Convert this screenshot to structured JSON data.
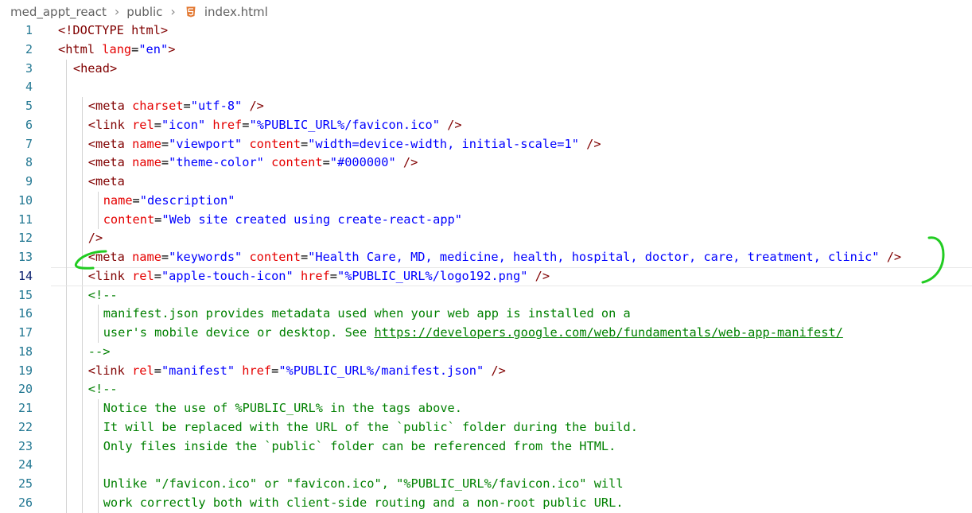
{
  "breadcrumb": {
    "items": [
      "med_appt_react",
      "public",
      "index.html"
    ],
    "file_icon": "html5-icon"
  },
  "editor": {
    "current_line": 14,
    "lines": [
      {
        "n": "1",
        "indent": 0,
        "tokens": [
          [
            "tag",
            "<!DOCTYPE html>"
          ]
        ]
      },
      {
        "n": "2",
        "indent": 0,
        "tokens": [
          [
            "tag",
            "<html"
          ],
          [
            "txt",
            " "
          ],
          [
            "attr",
            "lang"
          ],
          [
            "txt",
            "="
          ],
          [
            "str",
            "\"en\""
          ],
          [
            "tag",
            ">"
          ]
        ]
      },
      {
        "n": "3",
        "indent": 1,
        "tokens": [
          [
            "tag",
            "<head>"
          ]
        ]
      },
      {
        "n": "4",
        "indent": 1,
        "tokens": []
      },
      {
        "n": "5",
        "indent": 2,
        "tokens": [
          [
            "tag",
            "<meta"
          ],
          [
            "txt",
            " "
          ],
          [
            "attr",
            "charset"
          ],
          [
            "txt",
            "="
          ],
          [
            "str",
            "\"utf-8\""
          ],
          [
            "txt",
            " "
          ],
          [
            "tag",
            "/>"
          ]
        ]
      },
      {
        "n": "6",
        "indent": 2,
        "tokens": [
          [
            "tag",
            "<link"
          ],
          [
            "txt",
            " "
          ],
          [
            "attr",
            "rel"
          ],
          [
            "txt",
            "="
          ],
          [
            "str",
            "\"icon\""
          ],
          [
            "txt",
            " "
          ],
          [
            "attr",
            "href"
          ],
          [
            "txt",
            "="
          ],
          [
            "str",
            "\"%PUBLIC_URL%/favicon.ico\""
          ],
          [
            "txt",
            " "
          ],
          [
            "tag",
            "/>"
          ]
        ]
      },
      {
        "n": "7",
        "indent": 2,
        "tokens": [
          [
            "tag",
            "<meta"
          ],
          [
            "txt",
            " "
          ],
          [
            "attr",
            "name"
          ],
          [
            "txt",
            "="
          ],
          [
            "str",
            "\"viewport\""
          ],
          [
            "txt",
            " "
          ],
          [
            "attr",
            "content"
          ],
          [
            "txt",
            "="
          ],
          [
            "str",
            "\"width=device-width, initial-scale=1\""
          ],
          [
            "txt",
            " "
          ],
          [
            "tag",
            "/>"
          ]
        ]
      },
      {
        "n": "8",
        "indent": 2,
        "tokens": [
          [
            "tag",
            "<meta"
          ],
          [
            "txt",
            " "
          ],
          [
            "attr",
            "name"
          ],
          [
            "txt",
            "="
          ],
          [
            "str",
            "\"theme-color\""
          ],
          [
            "txt",
            " "
          ],
          [
            "attr",
            "content"
          ],
          [
            "txt",
            "="
          ],
          [
            "str",
            "\"#000000\""
          ],
          [
            "txt",
            " "
          ],
          [
            "tag",
            "/>"
          ]
        ]
      },
      {
        "n": "9",
        "indent": 2,
        "tokens": [
          [
            "tag",
            "<meta"
          ]
        ]
      },
      {
        "n": "10",
        "indent": 3,
        "tokens": [
          [
            "attr",
            "name"
          ],
          [
            "txt",
            "="
          ],
          [
            "str",
            "\"description\""
          ]
        ]
      },
      {
        "n": "11",
        "indent": 3,
        "tokens": [
          [
            "attr",
            "content"
          ],
          [
            "txt",
            "="
          ],
          [
            "str",
            "\"Web site created using create-react-app\""
          ]
        ]
      },
      {
        "n": "12",
        "indent": 2,
        "tokens": [
          [
            "tag",
            "/>"
          ]
        ]
      },
      {
        "n": "13",
        "indent": 2,
        "tokens": [
          [
            "tag",
            "<meta"
          ],
          [
            "txt",
            " "
          ],
          [
            "attr",
            "name"
          ],
          [
            "txt",
            "="
          ],
          [
            "str",
            "\"keywords\""
          ],
          [
            "txt",
            " "
          ],
          [
            "attr",
            "content"
          ],
          [
            "txt",
            "="
          ],
          [
            "str",
            "\"Health Care, MD, medicine, health, hospital, doctor, care, treatment, clinic\""
          ],
          [
            "txt",
            " "
          ],
          [
            "tag",
            "/>"
          ]
        ]
      },
      {
        "n": "14",
        "indent": 2,
        "tokens": [
          [
            "tag",
            "<link"
          ],
          [
            "txt",
            " "
          ],
          [
            "attr",
            "rel"
          ],
          [
            "txt",
            "="
          ],
          [
            "str",
            "\"apple-touch-icon\""
          ],
          [
            "txt",
            " "
          ],
          [
            "attr",
            "href"
          ],
          [
            "txt",
            "="
          ],
          [
            "str",
            "\"%PUBLIC_URL%/logo192.png\""
          ],
          [
            "txt",
            " "
          ],
          [
            "tag",
            "/>"
          ]
        ]
      },
      {
        "n": "15",
        "indent": 2,
        "tokens": [
          [
            "cmt",
            "<!--"
          ]
        ]
      },
      {
        "n": "16",
        "indent": 3,
        "tokens": [
          [
            "cmt",
            "manifest.json provides metadata used when your web app is installed on a"
          ]
        ]
      },
      {
        "n": "17",
        "indent": 3,
        "tokens": [
          [
            "cmt",
            "user's mobile device or desktop. See "
          ],
          [
            "link",
            "https://developers.google.com/web/fundamentals/web-app-manifest/"
          ]
        ]
      },
      {
        "n": "18",
        "indent": 2,
        "tokens": [
          [
            "cmt",
            "-->"
          ]
        ]
      },
      {
        "n": "19",
        "indent": 2,
        "tokens": [
          [
            "tag",
            "<link"
          ],
          [
            "txt",
            " "
          ],
          [
            "attr",
            "rel"
          ],
          [
            "txt",
            "="
          ],
          [
            "str",
            "\"manifest\""
          ],
          [
            "txt",
            " "
          ],
          [
            "attr",
            "href"
          ],
          [
            "txt",
            "="
          ],
          [
            "str",
            "\"%PUBLIC_URL%/manifest.json\""
          ],
          [
            "txt",
            " "
          ],
          [
            "tag",
            "/>"
          ]
        ]
      },
      {
        "n": "20",
        "indent": 2,
        "tokens": [
          [
            "cmt",
            "<!--"
          ]
        ]
      },
      {
        "n": "21",
        "indent": 3,
        "tokens": [
          [
            "cmt",
            "Notice the use of %PUBLIC_URL% in the tags above."
          ]
        ]
      },
      {
        "n": "22",
        "indent": 3,
        "tokens": [
          [
            "cmt",
            "It will be replaced with the URL of the `public` folder during the build."
          ]
        ]
      },
      {
        "n": "23",
        "indent": 3,
        "tokens": [
          [
            "cmt",
            "Only files inside the `public` folder can be referenced from the HTML."
          ]
        ]
      },
      {
        "n": "24",
        "indent": 3,
        "tokens": []
      },
      {
        "n": "25",
        "indent": 3,
        "tokens": [
          [
            "cmt",
            "Unlike \"/favicon.ico\" or \"favicon.ico\", \"%PUBLIC_URL%/favicon.ico\" will"
          ]
        ]
      },
      {
        "n": "26",
        "indent": 3,
        "tokens": [
          [
            "cmt",
            "work correctly both with client-side routing and a non-root public URL."
          ]
        ]
      }
    ]
  },
  "annotation": {
    "color": "#22cc22",
    "marks": [
      "open-bracket-mark",
      "close-bracket-mark"
    ],
    "highlighted_line": 13
  }
}
